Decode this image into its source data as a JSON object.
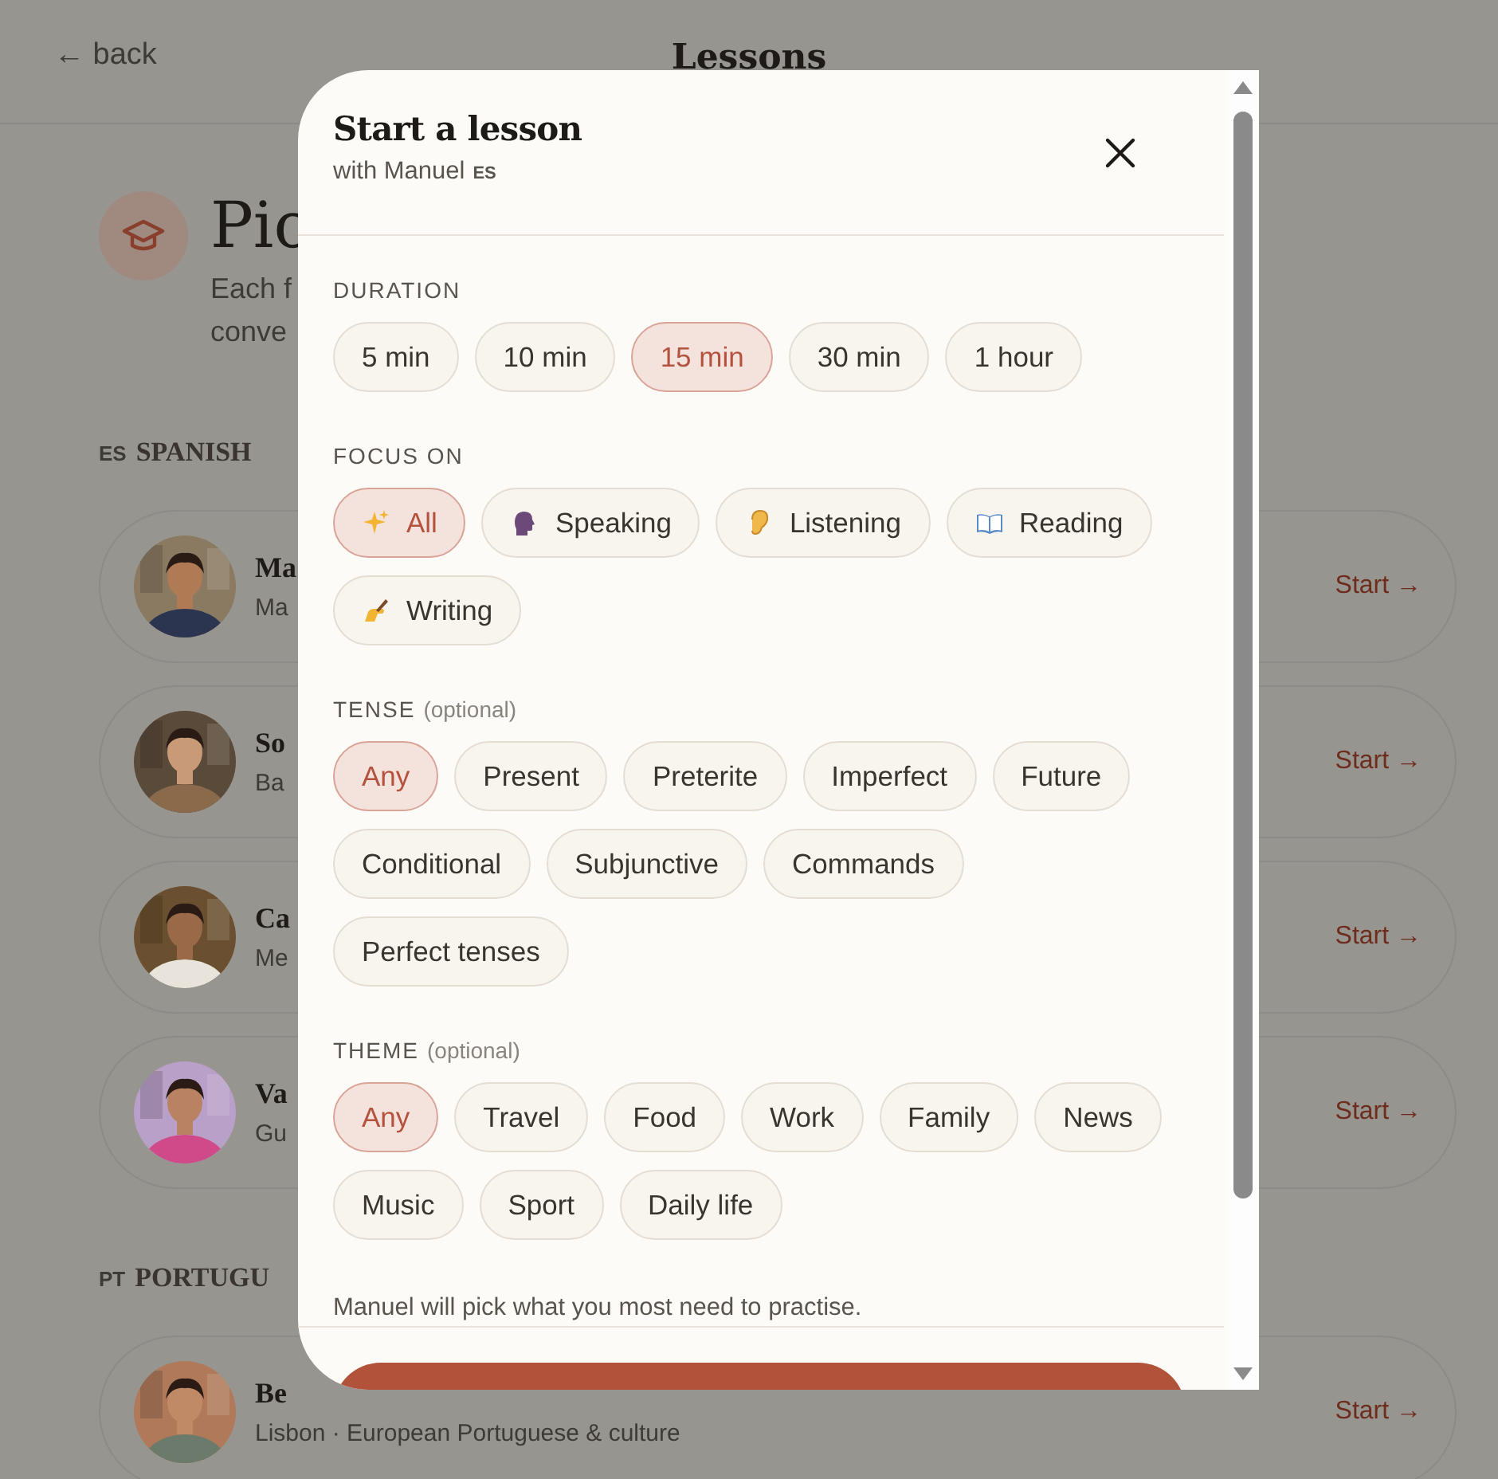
{
  "header": {
    "back": "← back",
    "title": "Lessons"
  },
  "hero": {
    "title": "Pic",
    "lines": [
      "Each f",
      "conve"
    ]
  },
  "groups": [
    {
      "code": "ES",
      "name": "SPANISH",
      "tutors": [
        {
          "name": "Ma",
          "sub": "Ma",
          "action": "Start →"
        },
        {
          "name": "So",
          "sub": "Ba",
          "action": "Start →"
        },
        {
          "name": "Ca",
          "sub": "Me",
          "action": "Start →"
        },
        {
          "name": "Va",
          "sub": "Gu",
          "action": "Start →"
        }
      ]
    },
    {
      "code": "PT",
      "name": "PORTUGU",
      "tutors": [
        {
          "name": "Be",
          "sub": "Lisbon · European Portuguese & culture",
          "action": "Start →"
        }
      ]
    }
  ],
  "modal": {
    "title": "Start a lesson",
    "subtitle": "with Manuel",
    "lang_code": "ES",
    "sections": [
      {
        "label": "DURATION",
        "options": [
          {
            "label": "5 min",
            "selected": false
          },
          {
            "label": "10 min",
            "selected": false
          },
          {
            "label": "15 min",
            "selected": true
          },
          {
            "label": "30 min",
            "selected": false
          },
          {
            "label": "1 hour",
            "selected": false
          }
        ]
      },
      {
        "label": "FOCUS ON",
        "icons": true,
        "options": [
          {
            "label": "All",
            "selected": true
          },
          {
            "label": "Speaking",
            "selected": false
          },
          {
            "label": "Listening",
            "selected": false
          },
          {
            "label": "Reading",
            "selected": false
          },
          {
            "label": "Writing",
            "selected": false
          }
        ]
      },
      {
        "label": "TENSE",
        "hint": "(optional)",
        "options": [
          {
            "label": "Any",
            "selected": true
          },
          {
            "label": "Present",
            "selected": false
          },
          {
            "label": "Preterite",
            "selected": false
          },
          {
            "label": "Imperfect",
            "selected": false
          },
          {
            "label": "Future",
            "selected": false
          },
          {
            "label": "Conditional",
            "selected": false
          },
          {
            "label": "Subjunctive",
            "selected": false
          },
          {
            "label": "Commands",
            "selected": false
          },
          {
            "label": "Perfect tenses",
            "selected": false
          }
        ]
      },
      {
        "label": "THEME",
        "hint": "(optional)",
        "options": [
          {
            "label": "Any",
            "selected": true
          },
          {
            "label": "Travel",
            "selected": false
          },
          {
            "label": "Food",
            "selected": false
          },
          {
            "label": "Work",
            "selected": false
          },
          {
            "label": "Family",
            "selected": false
          },
          {
            "label": "News",
            "selected": false
          },
          {
            "label": "Music",
            "selected": false
          },
          {
            "label": "Sport",
            "selected": false
          },
          {
            "label": "Daily life",
            "selected": false
          }
        ]
      }
    ],
    "note": "Manuel will pick what you most need to practise."
  }
}
